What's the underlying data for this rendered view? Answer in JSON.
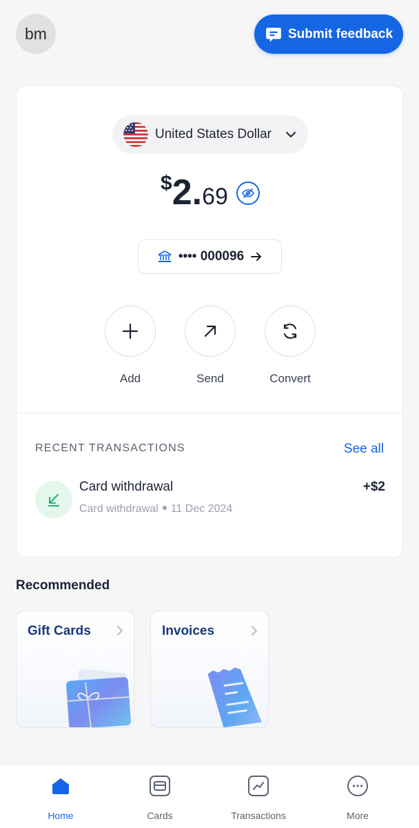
{
  "header": {
    "avatar_initials": "bm",
    "feedback_label": "Submit feedback"
  },
  "balance_card": {
    "currency_name": "United States Dollar",
    "balance_symbol": "$",
    "balance_whole": "2.",
    "balance_decimal": "69",
    "account_mask": "•••• 000096",
    "actions": [
      {
        "label": "Add",
        "icon": "plus-icon"
      },
      {
        "label": "Send",
        "icon": "arrow-up-right-icon"
      },
      {
        "label": "Convert",
        "icon": "refresh-icon"
      }
    ]
  },
  "recent": {
    "title": "RECENT TRANSACTIONS",
    "see_all": "See all",
    "transactions": [
      {
        "name": "Card withdrawal",
        "type": "Card withdrawal",
        "date": "11 Dec 2024",
        "amount": "+$2"
      }
    ]
  },
  "recommended": {
    "title": "Recommended",
    "cards": [
      {
        "label": "Gift Cards"
      },
      {
        "label": "Invoices"
      }
    ]
  },
  "nav": {
    "items": [
      {
        "label": "Home",
        "icon": "home-icon",
        "active": true
      },
      {
        "label": "Cards",
        "icon": "card-icon",
        "active": false
      },
      {
        "label": "Transactions",
        "icon": "chart-icon",
        "active": false
      },
      {
        "label": "More",
        "icon": "more-icon",
        "active": false
      }
    ]
  },
  "colors": {
    "accent": "#1466e4",
    "background": "#f6f6f7",
    "positive_bg": "#e3f7ec",
    "positive": "#22b26b"
  }
}
